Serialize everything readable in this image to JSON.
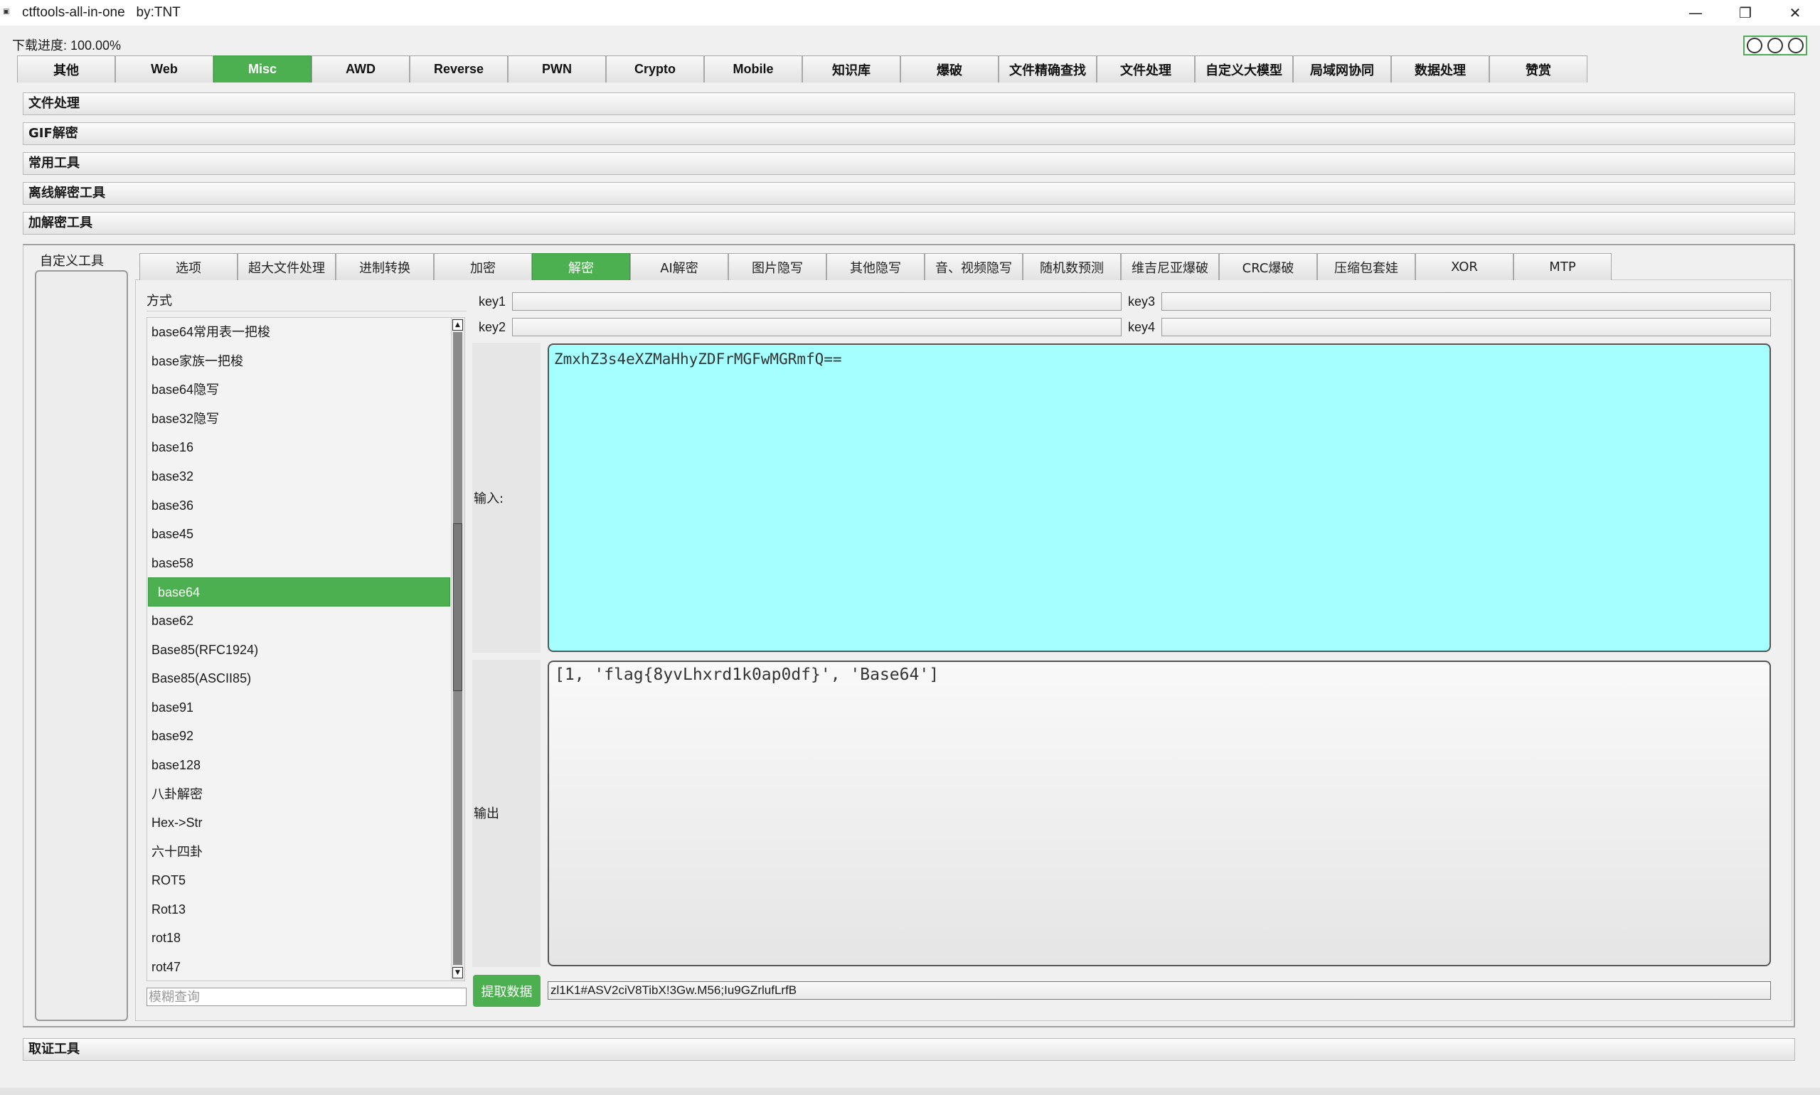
{
  "window": {
    "title": "ctftools-all-in-one   by:TNT",
    "icon": "app-icon",
    "controls": {
      "minimize": "—",
      "maximize": "❐",
      "close": "✕"
    }
  },
  "progress": {
    "label": "下载进度: 100.00%"
  },
  "main_tabs": [
    "其他",
    "Web",
    "Misc",
    "AWD",
    "Reverse",
    "PWN",
    "Crypto",
    "Mobile",
    "知识库",
    "爆破",
    "文件精确查找",
    "文件处理",
    "自定义大模型",
    "局域网协同",
    "数据处理",
    "赞赏"
  ],
  "main_tab_active": "Misc",
  "sections": {
    "file_processing": "文件处理",
    "gif_decrypt": "GIF解密",
    "common_tools": "常用工具",
    "offline_decrypt": "离线解密工具",
    "crypto_tools": "加解密工具",
    "forensics_tools": "取证工具"
  },
  "custom_tool": {
    "label": "自定义工具"
  },
  "sub_tabs": [
    "选项",
    "超大文件处理",
    "进制转换",
    "加密",
    "解密",
    "AI解密",
    "图片隐写",
    "其他隐写",
    "音、视频隐写",
    "随机数预测",
    "维吉尼亚爆破",
    "CRC爆破",
    "压缩包套娃",
    "XOR",
    "MTP"
  ],
  "sub_tab_active": "解密",
  "method": {
    "header": "方式",
    "items": [
      "base64常用表一把梭",
      "base家族一把梭",
      "base64隐写",
      "base32隐写",
      "base16",
      "base32",
      "base36",
      "base45",
      "base58",
      "base64",
      "base62",
      "Base85(RFC1924)",
      "Base85(ASCII85)",
      "base91",
      "base92",
      "base128",
      "八卦解密",
      "Hex->Str",
      "六十四卦",
      "ROT5",
      "Rot13",
      "rot18",
      "rot47"
    ],
    "selected": "base64",
    "search_placeholder": "模糊查询"
  },
  "keys": {
    "key1": "key1",
    "key2": "key2",
    "key3": "key3",
    "key4": "key4"
  },
  "io": {
    "input_label": "输入:",
    "input_value": "ZmxhZ3s4eXZMaHhyZDFrMGFwMGRmfQ==",
    "output_label": "输出",
    "output_value": "[1, 'flag{8yvLhxrd1k0ap0df}', 'Base64']",
    "extract_button": "提取数据",
    "extract_value": "zl1K1#ASV2ciV8TibX!3Gw.M56;Iu9GZrlufLrfB"
  },
  "colors": {
    "accent": "#4caf50",
    "input_bg": "#a6ffff"
  }
}
